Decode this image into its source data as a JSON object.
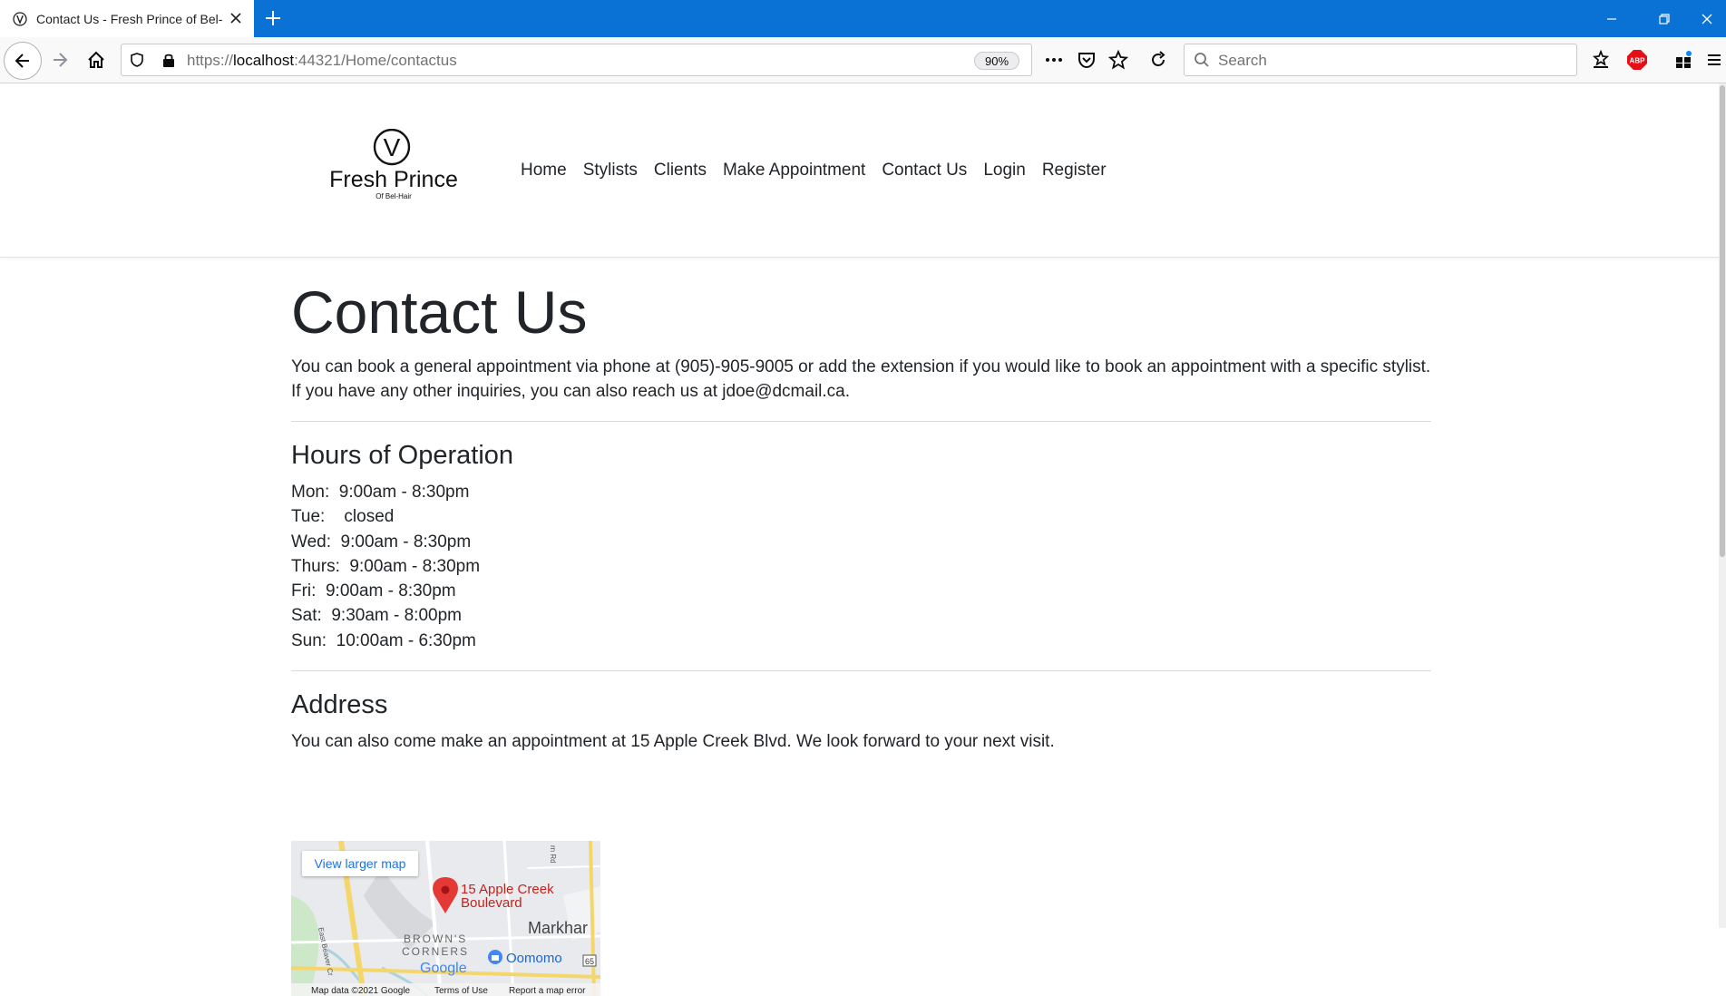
{
  "browser": {
    "tab_title": "Contact Us - Fresh Prince of Bel-Air",
    "url_prefix": "https://",
    "url_host": "localhost",
    "url_rest": ":44321/Home/contactus",
    "zoom": "90%",
    "search_placeholder": "Search",
    "accent_color": "#0a72d4"
  },
  "site": {
    "logo_letter": "V",
    "logo_name": "Fresh Prince",
    "logo_tagline": "Of Bel-Hair",
    "nav": [
      "Home",
      "Stylists",
      "Clients",
      "Make Appointment",
      "Contact Us",
      "Login",
      "Register"
    ]
  },
  "contact": {
    "title": "Contact Us",
    "intro_line1": "You can book a general appointment via phone at (905)-905-9005 or add the extension if you would like to book an appointment with a specific stylist.",
    "intro_line2": "If you have any other inquiries, you can also reach us at jdoe@dcmail.ca.",
    "hours_heading": "Hours of Operation",
    "hours": [
      "Mon:  9:00am - 8:30pm",
      "Tue:    closed",
      "Wed:  9:00am - 8:30pm",
      "Thurs:  9:00am - 8:30pm",
      "Fri:  9:00am - 8:30pm",
      "Sat:  9:30am - 8:00pm",
      "Sun:  10:00am - 6:30pm"
    ],
    "address_heading": "Address",
    "address_text": "You can also come make an appointment at 15 Apple Creek Blvd. We look forward to your next visit."
  },
  "map": {
    "view_larger": "View larger map",
    "pin_label_1": "15 Apple Creek",
    "pin_label_2": "Boulevard",
    "area_label": "Markhar",
    "corners_1": "BROWN'S",
    "corners_2": "CORNERS",
    "poi": "Oomomo",
    "google": "Google",
    "road_label": "East Beaver Cr",
    "road_label_2": "rn Rd",
    "highway": "65",
    "footer_data": "Map data ©2021 Google",
    "footer_terms": "Terms of Use",
    "footer_report": "Report a map error"
  }
}
